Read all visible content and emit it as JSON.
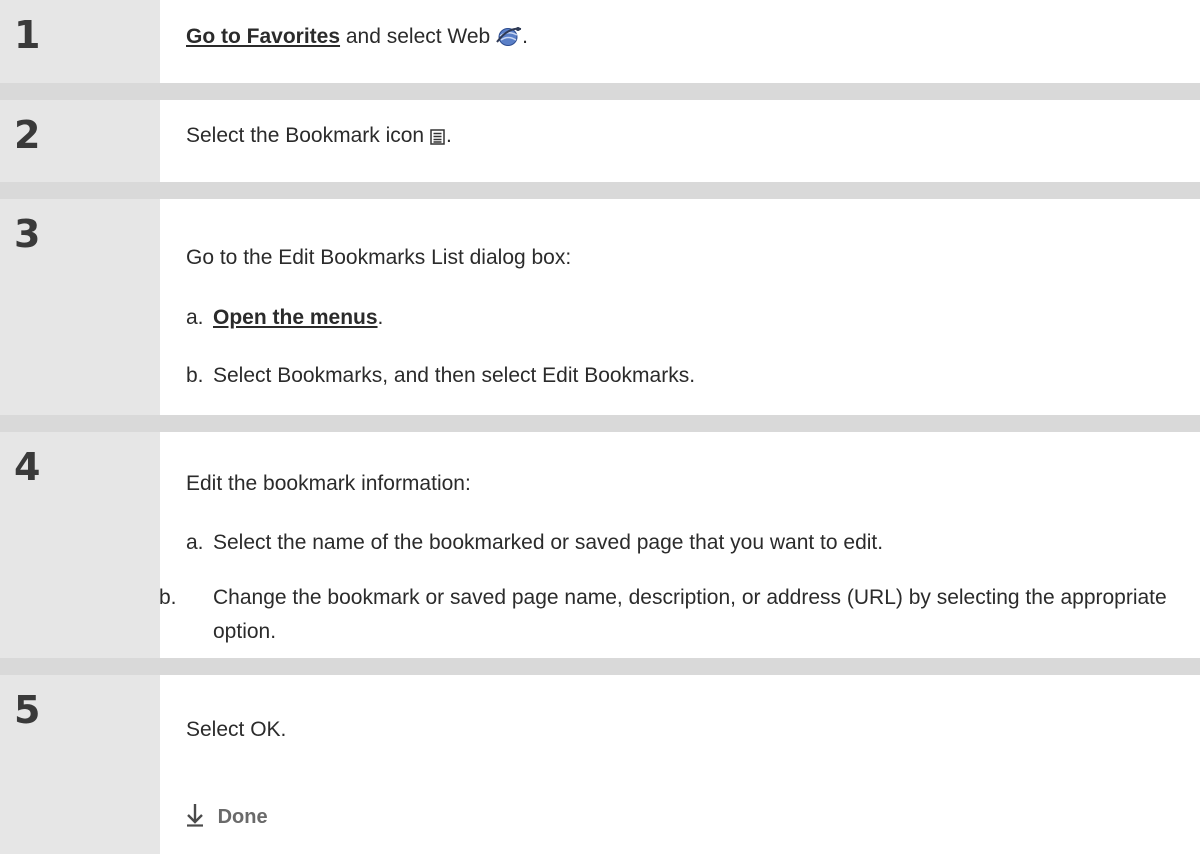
{
  "steps": [
    {
      "number": "1",
      "link": "Go to Favorites",
      "text_after_link": " and select Web ",
      "suffix": ".",
      "icon": "web-globe-icon"
    },
    {
      "number": "2",
      "text": "Select the Bookmark icon ",
      "suffix": ".",
      "icon": "bookmark-list-icon"
    },
    {
      "number": "3",
      "intro": "Go to the Edit Bookmarks List dialog box:",
      "sub": [
        {
          "prefix": "a.",
          "link": "Open the menus",
          "suffix": "."
        },
        {
          "prefix": "b.",
          "text": "Select Bookmarks, and then select Edit Bookmarks."
        }
      ]
    },
    {
      "number": "4",
      "intro": "Edit the bookmark information:",
      "sub": [
        {
          "prefix": "a.",
          "text": "Select the name of the bookmarked or saved page that you want to edit."
        },
        {
          "prefix": "b.",
          "text": "Change the bookmark or saved page name, description, or address (URL) by selecting the appropriate option."
        }
      ]
    },
    {
      "number": "5",
      "text": "Select OK.",
      "done_label": "Done",
      "done_icon": "done-arrow-icon"
    }
  ],
  "colors": {
    "number_column": "#e6e6e6",
    "separator": "#d9d9d9",
    "text": "#2b2b2b",
    "done": "#6a6a6a"
  }
}
